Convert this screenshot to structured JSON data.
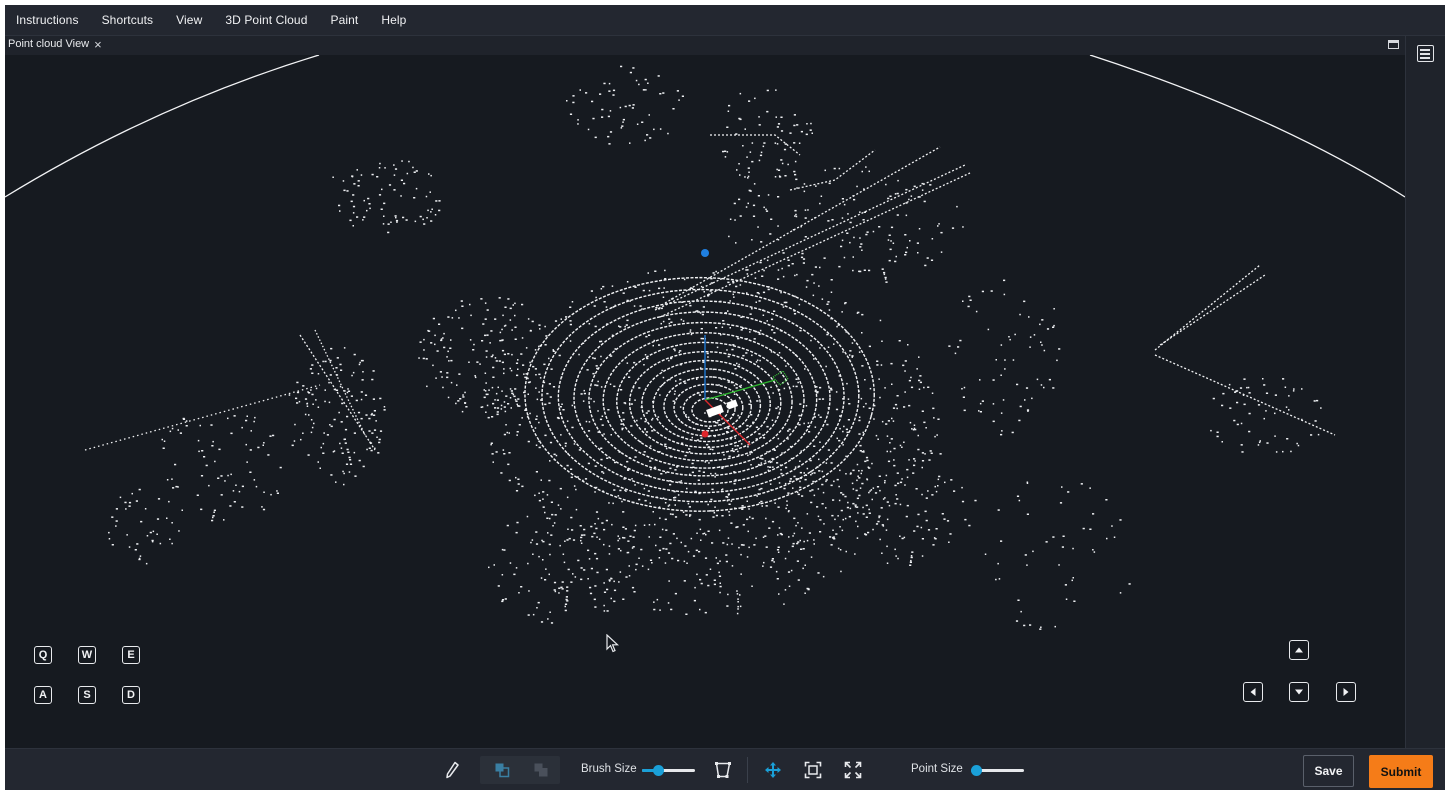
{
  "menu": {
    "items": [
      "Instructions",
      "Shortcuts",
      "View",
      "3D Point Cloud",
      "Paint",
      "Help"
    ]
  },
  "tab": {
    "label": "Point cloud View",
    "close": "×"
  },
  "keys": {
    "q": "Q",
    "w": "W",
    "e": "E",
    "a": "A",
    "s": "S",
    "d": "D"
  },
  "toolbar": {
    "brush_size_label": "Brush Size",
    "brush_size_value": 0.3,
    "point_size_label": "Point Size",
    "point_size_value": 0.1,
    "save_label": "Save",
    "submit_label": "Submit"
  },
  "colors": {
    "accent": "#1aa0d8",
    "submit": "#f57c18",
    "background": "#161a20",
    "x_axis": "#e0262b",
    "y_axis": "#2fb92f",
    "z_axis": "#1f7fe0"
  }
}
